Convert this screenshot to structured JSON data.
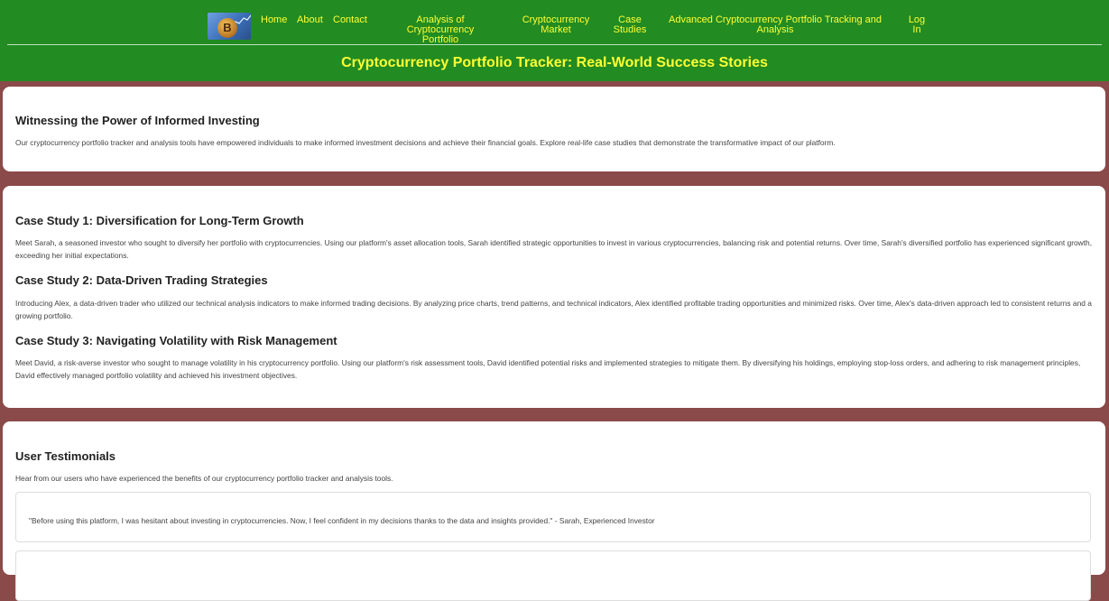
{
  "nav": {
    "items": [
      {
        "label": "Home"
      },
      {
        "label": "About"
      },
      {
        "label": "Contact"
      },
      {
        "label": "Analysis of Cryptocurrency\nPortfolio"
      },
      {
        "label": "Cryptocurrency\nMarket"
      },
      {
        "label": "Case\nStudies"
      },
      {
        "label": "Advanced Cryptocurrency Portfolio Tracking and\nAnalysis"
      },
      {
        "label": "Log\nIn"
      }
    ]
  },
  "logo": {
    "glyph": "B",
    "icon": "bitcoin-logo-icon"
  },
  "header": {
    "title": "Cryptocurrency Portfolio Tracker: Real-World Success Stories"
  },
  "intro": {
    "heading": "Witnessing the Power of Informed Investing",
    "text": "Our cryptocurrency portfolio tracker and analysis tools have empowered individuals to make informed investment decisions and achieve their financial goals. Explore real-life case studies that demonstrate the transformative impact of our platform."
  },
  "cases": [
    {
      "heading": "Case Study 1: Diversification for Long-Term Growth",
      "text": "Meet Sarah, a seasoned investor who sought to diversify her portfolio with cryptocurrencies. Using our platform's asset allocation tools, Sarah identified strategic opportunities to invest in various cryptocurrencies, balancing risk and potential returns. Over time, Sarah's diversified portfolio has experienced significant growth, exceeding her initial expectations."
    },
    {
      "heading": "Case Study 2: Data-Driven Trading Strategies",
      "text": "Introducing Alex, a data-driven trader who utilized our technical analysis indicators to make informed trading decisions. By analyzing price charts, trend patterns, and technical indicators, Alex identified profitable trading opportunities and minimized risks. Over time, Alex's data-driven approach led to consistent returns and a growing portfolio."
    },
    {
      "heading": "Case Study 3: Navigating Volatility with Risk Management",
      "text": "Meet David, a risk-averse investor who sought to manage volatility in his cryptocurrency portfolio. Using our platform's risk assessment tools, David identified potential risks and implemented strategies to mitigate them. By diversifying his holdings, employing stop-loss orders, and adhering to risk management principles, David effectively managed portfolio volatility and achieved his investment objectives."
    }
  ],
  "testimonials": {
    "heading": "User Testimonials",
    "intro": "Hear from our users who have experienced the benefits of our cryptocurrency portfolio tracker and analysis tools.",
    "items": [
      {
        "quote": "\"Before using this platform, I was hesitant about investing in cryptocurrencies. Now, I feel confident in my decisions thanks to the data and insights provided.\" - Sarah, Experienced Investor"
      }
    ]
  },
  "colors": {
    "header": "#228b22",
    "nav_text": "#ffff33",
    "divider": "#8b4a4a"
  }
}
